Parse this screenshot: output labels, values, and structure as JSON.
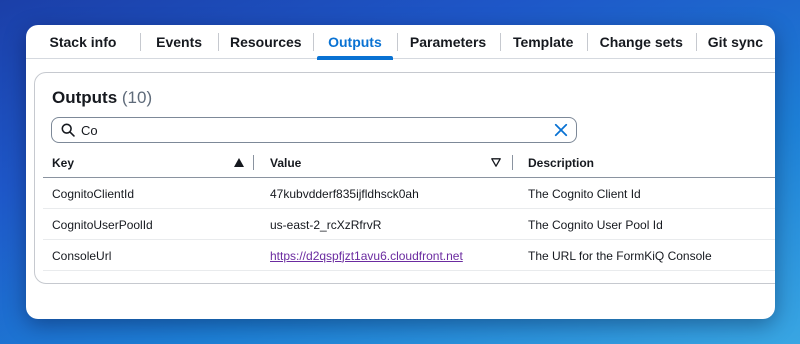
{
  "tabs": [
    {
      "label": "Stack info"
    },
    {
      "label": "Events"
    },
    {
      "label": "Resources"
    },
    {
      "label": "Outputs",
      "active": true
    },
    {
      "label": "Parameters"
    },
    {
      "label": "Template"
    },
    {
      "label": "Change sets"
    },
    {
      "label": "Git sync"
    }
  ],
  "outputs": {
    "title": "Outputs",
    "count": "(10)",
    "search": {
      "value": "Co"
    },
    "columns": {
      "key": "Key",
      "value": "Value",
      "description": "Description"
    },
    "rows": [
      {
        "key": "CognitoClientId",
        "value": "47kubvdderf835ijfldhsck0ah",
        "description": "The Cognito Client Id"
      },
      {
        "key": "CognitoUserPoolId",
        "value": "us-east-2_rcXzRfrvR",
        "description": "The Cognito User Pool Id"
      },
      {
        "key": "ConsoleUrl",
        "value": "https://d2qspfjzt1avu6.cloudfront.net",
        "description": "The URL for the FormKiQ Console"
      }
    ]
  },
  "icons": {
    "search": "search-icon",
    "clear": "close-icon",
    "sort_key": "sort-ascending-icon",
    "sort_value": "sort-descending-icon"
  },
  "colors": {
    "accent": "#0972d3",
    "link_visited": "#6b2ba0",
    "text": "#16191f"
  }
}
